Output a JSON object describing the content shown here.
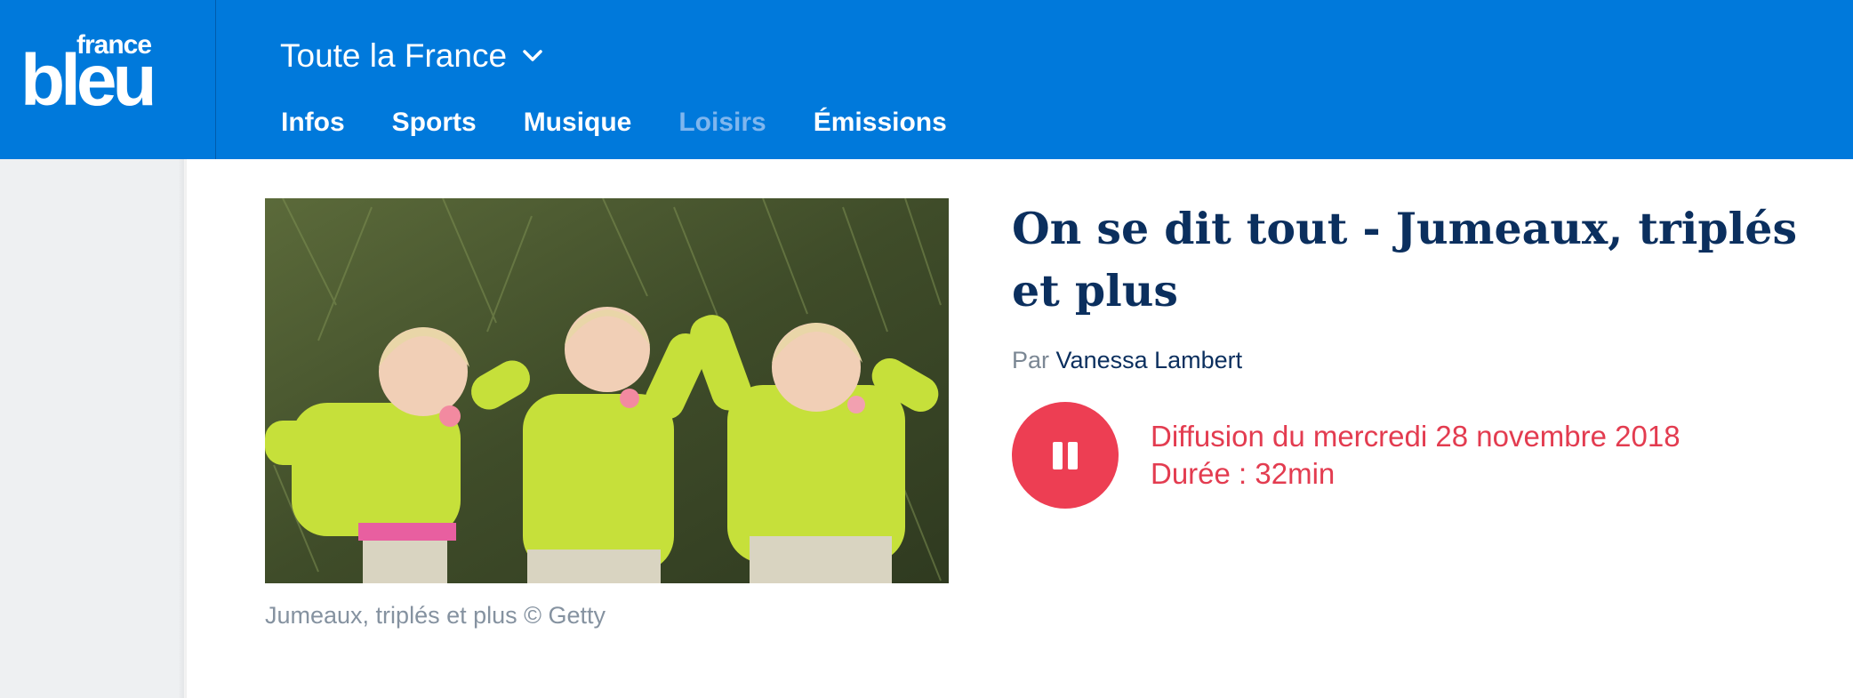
{
  "brand": {
    "france": "france",
    "bleu": "bleu",
    "color": "#0079db"
  },
  "header": {
    "region_label": "Toute la France",
    "nav": [
      {
        "label": "Infos",
        "active": false
      },
      {
        "label": "Sports",
        "active": false
      },
      {
        "label": "Musique",
        "active": false
      },
      {
        "label": "Loisirs",
        "active": true
      },
      {
        "label": "Émissions",
        "active": false
      }
    ]
  },
  "episode": {
    "title": "On se dit tout - Jumeaux, triplés et plus",
    "byline_prefix": "Par",
    "author": "Vanessa Lambert",
    "broadcast": "Diffusion du mercredi 28 novembre 2018",
    "duration": "Durée : 32min",
    "image_caption": "Jumeaux, triplés et plus © Getty",
    "player_state": "playing",
    "accent_color": "#ed3e53",
    "title_color": "#0b2f5e"
  }
}
